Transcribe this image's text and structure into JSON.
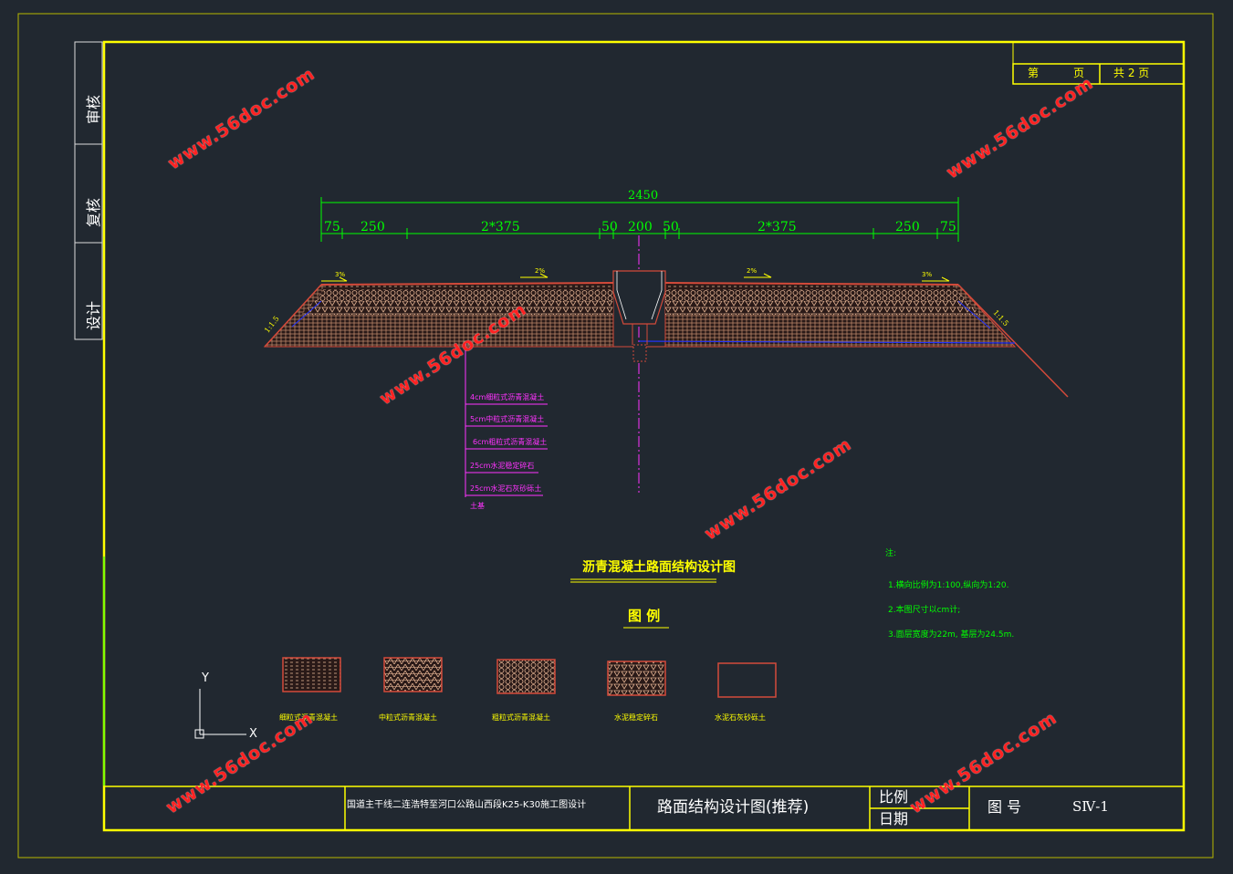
{
  "side_labels": {
    "review": "审核",
    "recheck": "复核",
    "design": "设计"
  },
  "page_box": {
    "page_prefix": "第",
    "page_label": "页",
    "total": "共 2 页"
  },
  "dimensions": {
    "total": "2450",
    "segments": [
      "75",
      "250",
      "2*375",
      "50",
      "200",
      "50",
      "2*375",
      "250",
      "75"
    ]
  },
  "slopes": {
    "left": "1:1.5",
    "right": "1:1.5"
  },
  "crossfall_labels": [
    "3%",
    "2%",
    "2%",
    "3%"
  ],
  "layer_callouts": [
    "4cm细粒式沥青混凝土",
    "5cm中粒式沥青混凝土",
    "6cm粗粒式沥青混凝土",
    "25cm水泥稳定碎石",
    "25cm水泥石灰砂砾土",
    "土基"
  ],
  "drawing_title": "沥青混凝土路面结构设计图",
  "legend": {
    "title": "图  例",
    "items": [
      {
        "label": "细粒式沥青混凝土",
        "pattern": "fine"
      },
      {
        "label": "中粒式沥青混凝土",
        "pattern": "medium"
      },
      {
        "label": "粗粒式沥青混凝土",
        "pattern": "coarse"
      },
      {
        "label": "水泥稳定碎石",
        "pattern": "stabilized"
      },
      {
        "label": "水泥石灰砂砾土",
        "pattern": "empty"
      }
    ]
  },
  "notes": {
    "heading": "注:",
    "items": [
      "1.横向比例为1:100,纵向为1:20.",
      "2.本图尺寸以cm计;",
      "3.面层宽度为22m, 基层为24.5m."
    ]
  },
  "ucs": {
    "y_label": "Y",
    "x_label": "X"
  },
  "title_block": {
    "project": "国道主干线二连浩特至河口公路山西段K25-K30施工图设计",
    "drawing_name": "路面结构设计图(推荐)",
    "scale_label": "比例",
    "date_label": "日期",
    "drawing_no_label": "图 号",
    "drawing_no": "SⅣ-1"
  },
  "watermark": {
    "text": "www.56doc.com"
  },
  "colors": {
    "background": "#212830",
    "frame": "#ffff00",
    "dimension": "#00ff00",
    "pavement": "#d44a3a",
    "callout": "#ff33ff",
    "subgrade_line": "#2233ff",
    "watermark": "#ff2222"
  }
}
